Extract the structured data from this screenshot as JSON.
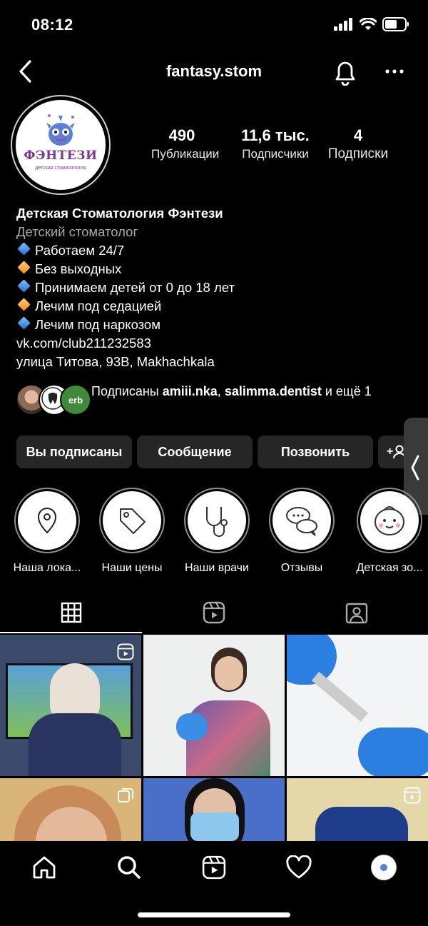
{
  "status": {
    "time": "08:12"
  },
  "header": {
    "username": "fantasy.stom"
  },
  "avatar": {
    "logo_text": "ФЭНТЕЗИ",
    "logo_subtext": "детская стоматология"
  },
  "stats": [
    {
      "value": "490",
      "label": "Публикации"
    },
    {
      "value": "11,6 тыс.",
      "label": "Подписчики"
    },
    {
      "value": "4",
      "label": "Подписки"
    }
  ],
  "bio": {
    "name": "Детская Стоматология Фэнтези",
    "category": "Детский стоматолог",
    "lines": [
      "Работаем 24/7",
      "Без выходных",
      "Принимаем детей от 0 до 18 лет",
      "Лечим под седацией",
      "Лечим под наркозом"
    ],
    "link": "vk.com/club211232583",
    "address": "улица Титова, 93В, Makhachkala"
  },
  "followed_by": {
    "prefix": "Подписаны ",
    "user1": "amiii.nka",
    "sep": ", ",
    "user2": "salimma.dentist",
    "suffix": " и ещё 1",
    "avatar3_text": "erb"
  },
  "buttons": {
    "following": "Вы подписаны",
    "message": "Сообщение",
    "call": "Позвонить",
    "add_person": "+"
  },
  "highlights": [
    {
      "label": "Наша лока...",
      "icon": "location-pin-icon"
    },
    {
      "label": "Наши цены",
      "icon": "price-tag-icon"
    },
    {
      "label": "Наши врачи",
      "icon": "stethoscope-icon"
    },
    {
      "label": "Отзывы",
      "icon": "chat-bubbles-icon"
    },
    {
      "label": "Детская зо...",
      "icon": "baby-face-icon"
    }
  ],
  "tabs": [
    "grid-icon",
    "reels-icon",
    "tagged-icon"
  ],
  "colors": {
    "background": "#000000",
    "button_bg": "#262626",
    "accent_blue": "#1f6fd6",
    "accent_orange": "#f08a12"
  }
}
